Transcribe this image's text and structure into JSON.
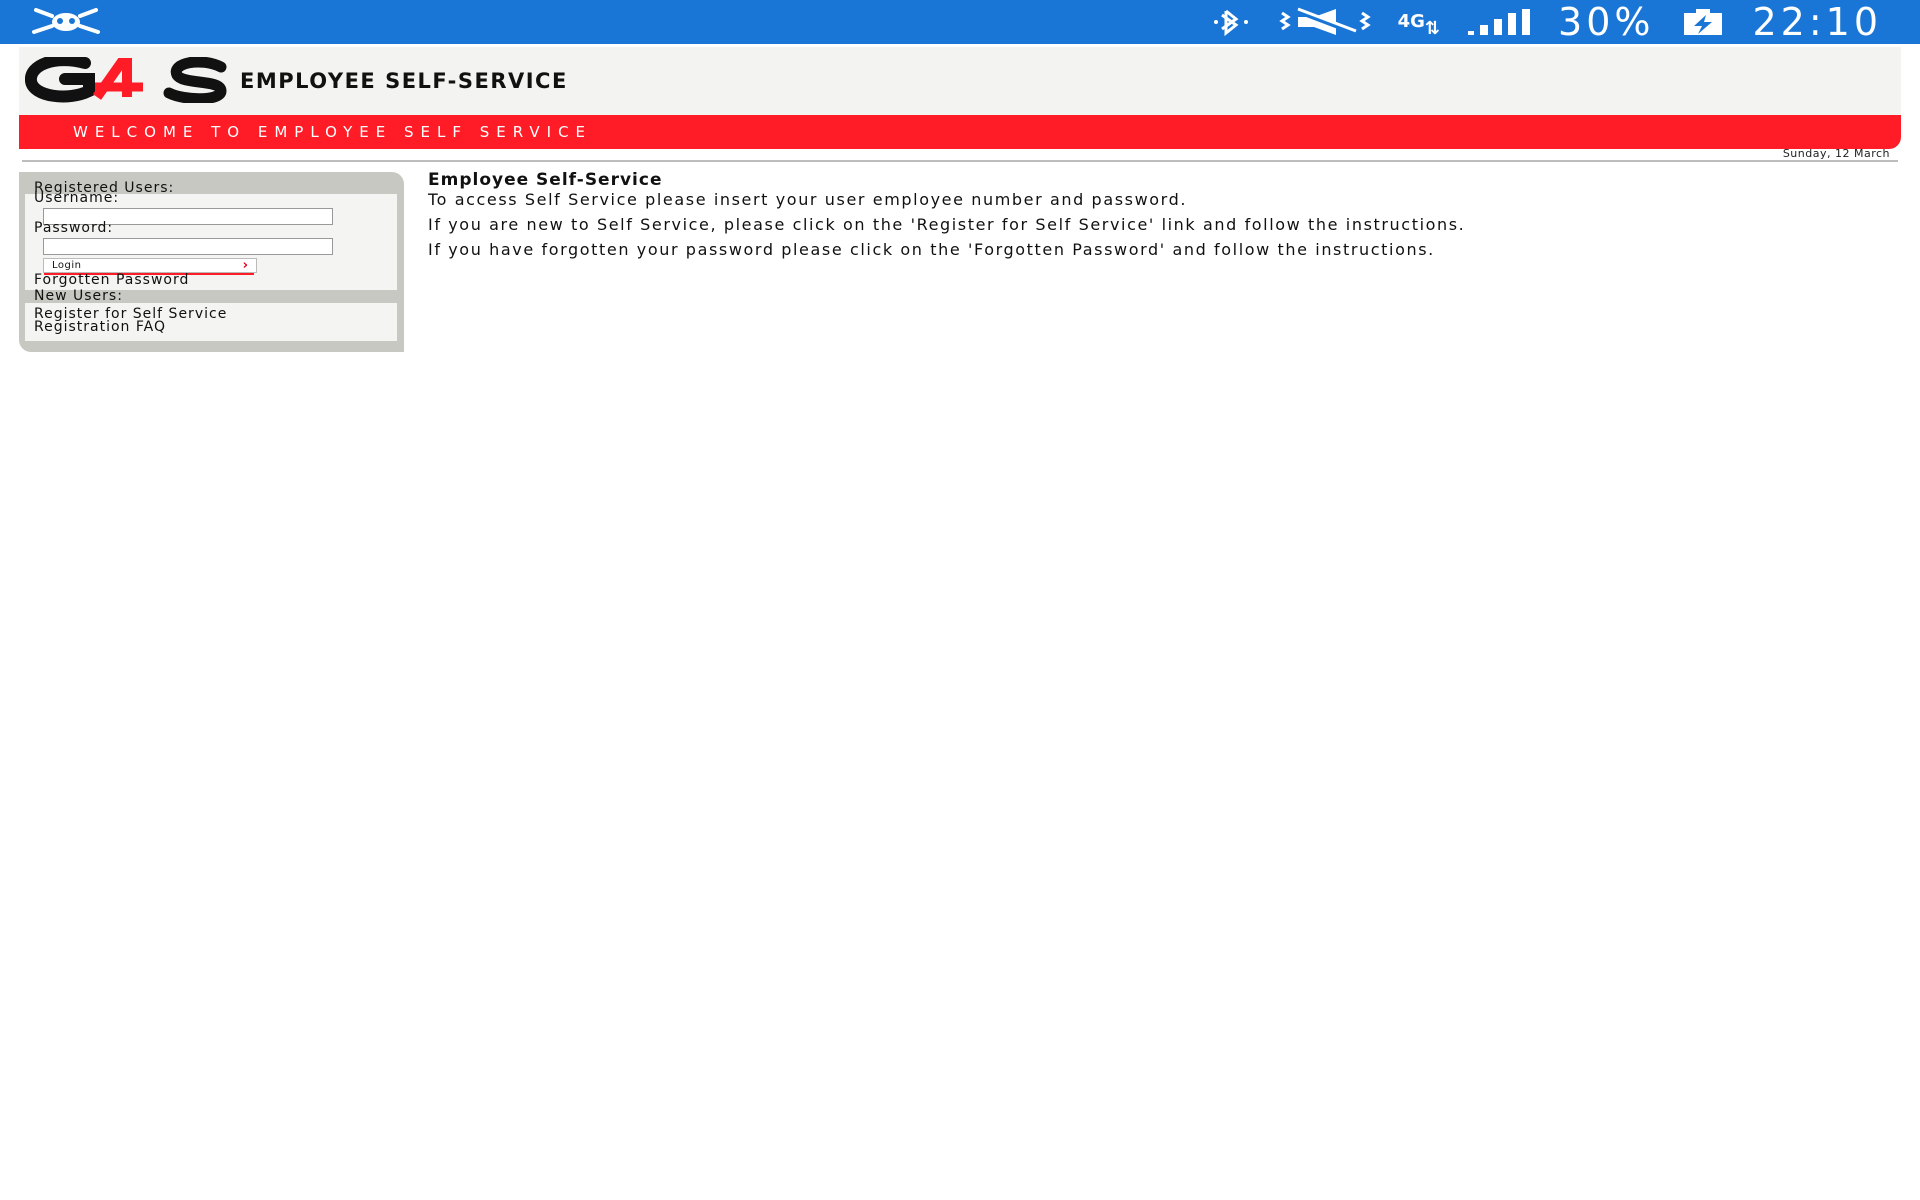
{
  "status_bar": {
    "left_icon": "bug-icon",
    "icons": [
      "bluetooth-icon",
      "vibrate-muted-icon",
      "network-4g-icon",
      "signal-bars-icon",
      "battery-charging-icon"
    ],
    "network_label": "4G",
    "battery_percent": "30%",
    "clock": "22:10",
    "color": "#1a76d6"
  },
  "header": {
    "logo_text": "G4S",
    "title": "EMPLOYEE SELF-SERVICE",
    "welcome": "WELCOME TO EMPLOYEE SELF SERVICE",
    "date": "Sunday, 12 March",
    "brand_red": "#ff1c27"
  },
  "sidebar": {
    "registered_heading": "Registered Users:",
    "username_label": "Username:",
    "username_value": "",
    "password_label": "Password:",
    "password_value": "",
    "login_label": "Login",
    "forgotten_password": "Forgotten Password",
    "new_users_heading": "New Users:",
    "register_link": "Register for Self Service",
    "faq_link": "Registration FAQ"
  },
  "main": {
    "title": "Employee Self-Service",
    "paragraphs": [
      "To access Self Service please insert your user employee number and password.",
      "If you are new to Self Service, please click on the 'Register for Self Service' link and follow the instructions.",
      "If you have forgotten your password please click on the 'Forgotten Password' and follow the instructions."
    ]
  }
}
